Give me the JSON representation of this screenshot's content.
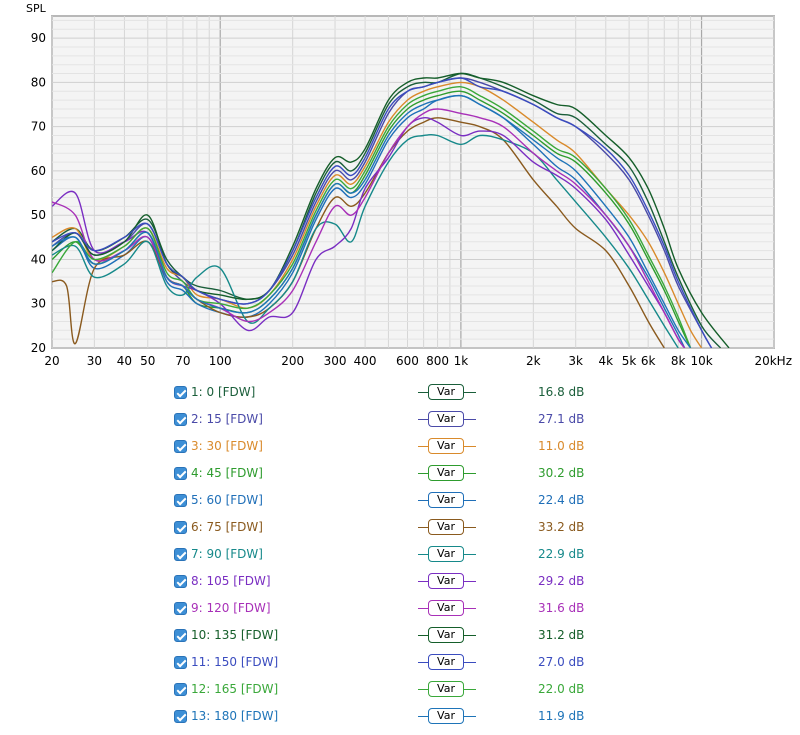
{
  "chart_data": {
    "type": "line",
    "title": "",
    "ylabel": "SPL",
    "xlabel": "",
    "xscale": "log",
    "xlim": [
      20,
      20000
    ],
    "ylim": [
      20,
      95
    ],
    "grid": true,
    "yticks": [
      20,
      30,
      40,
      50,
      60,
      70,
      80,
      90
    ],
    "xtick_labels": [
      {
        "v": 20,
        "t": "20"
      },
      {
        "v": 30,
        "t": "30"
      },
      {
        "v": 40,
        "t": "40"
      },
      {
        "v": 50,
        "t": "50"
      },
      {
        "v": 70,
        "t": "70"
      },
      {
        "v": 100,
        "t": "100"
      },
      {
        "v": 200,
        "t": "200"
      },
      {
        "v": 300,
        "t": "300"
      },
      {
        "v": 400,
        "t": "400"
      },
      {
        "v": 600,
        "t": "600"
      },
      {
        "v": 800,
        "t": "800"
      },
      {
        "v": 1000,
        "t": "1k"
      },
      {
        "v": 2000,
        "t": "2k"
      },
      {
        "v": 3000,
        "t": "3k"
      },
      {
        "v": 4000,
        "t": "4k"
      },
      {
        "v": 5000,
        "t": "5k"
      },
      {
        "v": 6000,
        "t": "6k"
      },
      {
        "v": 8000,
        "t": "8k"
      },
      {
        "v": 10000,
        "t": "10k"
      },
      {
        "v": 20000,
        "t": "20kHz"
      }
    ],
    "series": [
      {
        "name": "1: 0 [FDW]",
        "color": "#1a5e3a",
        "x": [
          20,
          25,
          30,
          40,
          50,
          60,
          70,
          80,
          100,
          130,
          160,
          200,
          250,
          300,
          350,
          400,
          500,
          600,
          700,
          800,
          1000,
          1200,
          1500,
          2000,
          2500,
          3000,
          4000,
          5000,
          6000,
          7000,
          8000,
          10000,
          12000
        ],
        "y": [
          44,
          47,
          42,
          45,
          49,
          40,
          36,
          34,
          33,
          31,
          33,
          42,
          55,
          62,
          60,
          64,
          75,
          79,
          80,
          80,
          82,
          81,
          79,
          76,
          73,
          72,
          66,
          61,
          53,
          44,
          36,
          25,
          20
        ]
      },
      {
        "name": "2: 15 [FDW]",
        "color": "#4a4aa8",
        "x": [
          20,
          25,
          30,
          40,
          50,
          60,
          70,
          80,
          100,
          130,
          160,
          200,
          250,
          300,
          350,
          400,
          500,
          600,
          700,
          800,
          1000,
          1200,
          1500,
          2000,
          2500,
          3000,
          4000,
          5000,
          6000,
          7000,
          8000,
          10000,
          11000
        ],
        "y": [
          43,
          46,
          41,
          44,
          48,
          39,
          35,
          33,
          31,
          30,
          33,
          41,
          53,
          60,
          58,
          62,
          73,
          78,
          79,
          80,
          81,
          80,
          78,
          75,
          72,
          70,
          64,
          58,
          50,
          42,
          34,
          24,
          20
        ]
      },
      {
        "name": "3: 30 [FDW]",
        "color": "#d98a2b",
        "x": [
          20,
          25,
          30,
          40,
          50,
          60,
          70,
          80,
          100,
          130,
          160,
          200,
          250,
          300,
          350,
          400,
          500,
          600,
          700,
          800,
          1000,
          1200,
          1500,
          2000,
          2500,
          3000,
          4000,
          5000,
          6000,
          7000,
          8000,
          9000,
          10000
        ],
        "y": [
          45,
          47,
          40,
          43,
          47,
          38,
          36,
          32,
          31,
          29,
          32,
          40,
          52,
          59,
          57,
          61,
          71,
          76,
          78,
          79,
          80,
          79,
          76,
          71,
          67,
          64,
          56,
          50,
          44,
          37,
          30,
          24,
          20
        ]
      },
      {
        "name": "4: 45 [FDW]",
        "color": "#2e9c2e",
        "x": [
          20,
          25,
          30,
          40,
          50,
          60,
          70,
          80,
          100,
          130,
          160,
          200,
          250,
          300,
          350,
          400,
          500,
          600,
          700,
          800,
          1000,
          1200,
          1500,
          2000,
          2500,
          3000,
          4000,
          5000,
          6000,
          7000,
          8000,
          9000
        ],
        "y": [
          40,
          44,
          39,
          42,
          46,
          36,
          34,
          30,
          29,
          28,
          31,
          38,
          50,
          57,
          55,
          59,
          69,
          74,
          76,
          77,
          78,
          76,
          73,
          68,
          64,
          62,
          55,
          48,
          40,
          33,
          26,
          20
        ]
      },
      {
        "name": "5: 60 [FDW]",
        "color": "#1f6fb8",
        "x": [
          20,
          25,
          30,
          40,
          50,
          60,
          70,
          80,
          100,
          130,
          160,
          200,
          250,
          300,
          350,
          400,
          500,
          600,
          700,
          800,
          1000,
          1200,
          1500,
          2000,
          2500,
          3000,
          4000,
          5000,
          6000,
          7000,
          8000,
          8500
        ],
        "y": [
          42,
          45,
          38,
          41,
          45,
          35,
          33,
          30,
          28,
          27,
          30,
          37,
          49,
          56,
          54,
          57,
          67,
          72,
          74,
          76,
          77,
          75,
          72,
          66,
          61,
          58,
          50,
          43,
          36,
          29,
          23,
          20
        ]
      },
      {
        "name": "6: 75 [FDW]",
        "color": "#8a5a1e",
        "x": [
          20,
          23,
          25,
          30,
          40,
          50,
          60,
          70,
          80,
          100,
          130,
          160,
          200,
          250,
          300,
          350,
          400,
          500,
          600,
          700,
          800,
          1000,
          1200,
          1500,
          2000,
          2500,
          3000,
          4000,
          5000,
          6000,
          7000
        ],
        "y": [
          35,
          34,
          21,
          38,
          41,
          44,
          36,
          34,
          31,
          28,
          27,
          29,
          35,
          47,
          54,
          52,
          55,
          64,
          69,
          71,
          72,
          71,
          70,
          67,
          58,
          52,
          47,
          42,
          34,
          26,
          20
        ]
      },
      {
        "name": "7: 90 [FDW]",
        "color": "#16898a",
        "x": [
          20,
          25,
          30,
          40,
          50,
          60,
          70,
          80,
          100,
          130,
          160,
          200,
          250,
          300,
          350,
          400,
          500,
          600,
          700,
          800,
          1000,
          1200,
          1500,
          2000,
          2500,
          3000,
          4000,
          5000,
          6000,
          7000,
          8000
        ],
        "y": [
          41,
          43,
          36,
          39,
          44,
          34,
          32,
          36,
          38,
          26,
          29,
          35,
          47,
          48,
          44,
          52,
          62,
          67,
          68,
          68,
          66,
          68,
          67,
          64,
          58,
          53,
          45,
          38,
          31,
          25,
          20
        ]
      },
      {
        "name": "8: 105 [FDW]",
        "color": "#7a2ec2",
        "x": [
          20,
          25,
          30,
          40,
          50,
          60,
          70,
          80,
          100,
          130,
          160,
          200,
          250,
          300,
          350,
          400,
          500,
          600,
          700,
          800,
          1000,
          1200,
          1500,
          2000,
          2500,
          3000,
          4000,
          5000,
          6000,
          7000,
          8000,
          8500
        ],
        "y": [
          52,
          55,
          42,
          44,
          46,
          36,
          34,
          33,
          30,
          24,
          27,
          28,
          40,
          43,
          47,
          56,
          63,
          70,
          72,
          71,
          68,
          69,
          68,
          62,
          59,
          56,
          49,
          41,
          34,
          28,
          22,
          20
        ]
      },
      {
        "name": "9: 120 [FDW]",
        "color": "#a830b8",
        "x": [
          20,
          25,
          30,
          40,
          50,
          60,
          70,
          80,
          100,
          130,
          160,
          200,
          250,
          300,
          350,
          400,
          500,
          600,
          700,
          800,
          1000,
          1200,
          1500,
          2000,
          2500,
          3000,
          4000,
          5000,
          6000,
          7000,
          8000,
          8500
        ],
        "y": [
          53,
          50,
          40,
          42,
          45,
          36,
          34,
          31,
          29,
          26,
          28,
          33,
          44,
          52,
          50,
          54,
          64,
          70,
          73,
          74,
          73,
          72,
          70,
          64,
          60,
          57,
          50,
          43,
          35,
          28,
          22,
          20
        ]
      },
      {
        "name": "10: 135 [FDW]",
        "color": "#155e2a",
        "x": [
          20,
          25,
          30,
          40,
          50,
          60,
          70,
          80,
          100,
          130,
          160,
          200,
          250,
          300,
          350,
          400,
          500,
          600,
          700,
          800,
          1000,
          1200,
          1500,
          2000,
          2500,
          3000,
          4000,
          5000,
          6000,
          7000,
          8000,
          10000,
          13000
        ],
        "y": [
          42,
          46,
          41,
          44,
          50,
          39,
          36,
          33,
          32,
          31,
          33,
          43,
          56,
          63,
          62,
          65,
          76,
          80,
          81,
          81,
          82,
          81,
          80,
          77,
          75,
          74,
          68,
          63,
          56,
          47,
          38,
          28,
          20
        ]
      },
      {
        "name": "11: 150 [FDW]",
        "color": "#3a4cbf",
        "x": [
          20,
          25,
          30,
          40,
          50,
          60,
          70,
          80,
          100,
          130,
          160,
          200,
          250,
          300,
          350,
          400,
          500,
          600,
          700,
          800,
          1000,
          1200,
          1500,
          2000,
          2500,
          3000,
          4000,
          5000,
          6000,
          7000,
          8000,
          10000,
          11000
        ],
        "y": [
          44,
          46,
          42,
          45,
          48,
          39,
          36,
          33,
          31,
          30,
          33,
          42,
          54,
          61,
          59,
          63,
          74,
          78,
          79,
          80,
          81,
          79,
          78,
          75,
          72,
          70,
          65,
          59,
          51,
          43,
          35,
          24,
          20
        ]
      },
      {
        "name": "12: 165 [FDW]",
        "color": "#3aa83a",
        "x": [
          20,
          25,
          30,
          40,
          50,
          60,
          70,
          80,
          100,
          130,
          160,
          200,
          250,
          300,
          350,
          400,
          500,
          600,
          700,
          800,
          1000,
          1200,
          1500,
          2000,
          2500,
          3000,
          4000,
          5000,
          6000,
          7000,
          8000,
          9000
        ],
        "y": [
          37,
          44,
          40,
          43,
          47,
          37,
          35,
          31,
          30,
          29,
          32,
          39,
          51,
          58,
          56,
          60,
          70,
          75,
          77,
          78,
          79,
          77,
          74,
          69,
          65,
          63,
          56,
          49,
          41,
          34,
          27,
          20
        ]
      },
      {
        "name": "13: 180 [FDW]",
        "color": "#1e74b8",
        "x": [
          20,
          25,
          30,
          40,
          50,
          60,
          70,
          80,
          100,
          130,
          160,
          200,
          250,
          300,
          350,
          400,
          500,
          600,
          700,
          800,
          1000,
          1200,
          1500,
          2000,
          2500,
          3000,
          4000,
          5000,
          6000,
          7000,
          8000,
          9000
        ],
        "y": [
          43,
          45,
          39,
          42,
          46,
          36,
          34,
          31,
          29,
          28,
          31,
          38,
          50,
          57,
          55,
          58,
          68,
          73,
          75,
          76,
          77,
          75,
          72,
          67,
          63,
          60,
          52,
          45,
          37,
          30,
          24,
          20
        ]
      }
    ]
  },
  "legend": {
    "button_label": "Var",
    "items": [
      {
        "label": "1: 0 [FDW]",
        "value": "16.8 dB",
        "color": "#1a5e3a"
      },
      {
        "label": "2: 15 [FDW]",
        "value": "27.1 dB",
        "color": "#4a4aa8"
      },
      {
        "label": "3: 30 [FDW]",
        "value": "11.0 dB",
        "color": "#d98a2b"
      },
      {
        "label": "4: 45 [FDW]",
        "value": "30.2 dB",
        "color": "#2e9c2e"
      },
      {
        "label": "5: 60 [FDW]",
        "value": "22.4 dB",
        "color": "#1f6fb8"
      },
      {
        "label": "6: 75 [FDW]",
        "value": "33.2 dB",
        "color": "#8a5a1e"
      },
      {
        "label": "7: 90 [FDW]",
        "value": "22.9 dB",
        "color": "#16898a"
      },
      {
        "label": "8: 105 [FDW]",
        "value": "29.2 dB",
        "color": "#7a2ec2"
      },
      {
        "label": "9: 120 [FDW]",
        "value": "31.6 dB",
        "color": "#a830b8"
      },
      {
        "label": "10: 135 [FDW]",
        "value": "31.2 dB",
        "color": "#155e2a"
      },
      {
        "label": "11: 150 [FDW]",
        "value": "27.0 dB",
        "color": "#3a4cbf"
      },
      {
        "label": "12: 165 [FDW]",
        "value": "22.0 dB",
        "color": "#3aa83a"
      },
      {
        "label": "13: 180 [FDW]",
        "value": "11.9 dB",
        "color": "#1e74b8"
      }
    ]
  }
}
